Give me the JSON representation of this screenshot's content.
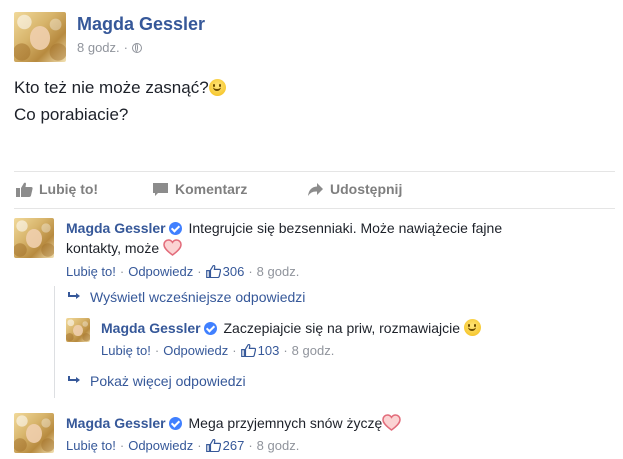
{
  "post": {
    "author": "Magda Gessler",
    "time": "8 godz.",
    "meta_sep": "·",
    "line1": "Kto też nie może zasnąć?",
    "line2": "Co porabiacie?"
  },
  "actions": {
    "like": "Lubię to!",
    "comment": "Komentarz",
    "share": "Udostępnij"
  },
  "comments": [
    {
      "author": "Magda Gessler",
      "text_line1": "Integrujcie się bezsenniaki. Może nawiążecie fajne",
      "text_line2": "kontakty, może",
      "like": "Lubię to!",
      "reply": "Odpowiedz",
      "likes": "306",
      "time": "8 godz.",
      "sep": "·"
    },
    {
      "author": "Magda Gessler",
      "text": "Zaczepiajcie się na priw, rozmawiajcie",
      "like": "Lubię to!",
      "reply": "Odpowiedz",
      "likes": "103",
      "time": "8 godz.",
      "sep": "·"
    },
    {
      "author": "Magda Gessler",
      "text": "Mega przyjemnych snów życzę",
      "like": "Lubię to!",
      "reply": "Odpowiedz",
      "likes": "267",
      "time": "8 godz.",
      "sep": "·"
    }
  ],
  "replies": {
    "show_earlier": "Wyświetl wcześniejsze odpowiedzi",
    "show_more": "Pokaż więcej odpowiedzi"
  },
  "colors": {
    "link": "#365899",
    "muted": "#90949c",
    "verified": "#4080ff"
  },
  "icons": [
    "globe-icon",
    "smile-emoji",
    "heart-emoji",
    "like-icon",
    "comment-icon",
    "share-icon",
    "verified-badge-icon",
    "reply-arrow-icon",
    "thumbs-up-icon"
  ]
}
